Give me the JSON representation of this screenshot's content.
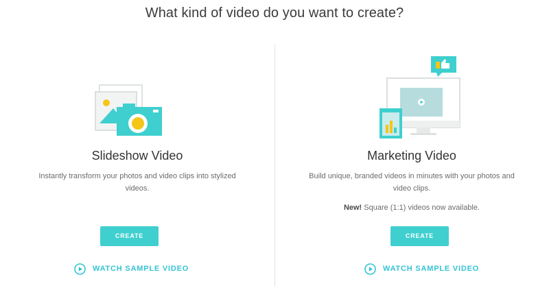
{
  "header": {
    "title": "What kind of video do you want to create?"
  },
  "cards": [
    {
      "id": "slideshow",
      "title": "Slideshow Video",
      "description": "Instantly transform your photos and video clips into stylized videos.",
      "create_label": "CREATE",
      "watch_label": "WATCH SAMPLE VIDEO",
      "illustration": "photo-camera-icon"
    },
    {
      "id": "marketing",
      "title": "Marketing Video",
      "description": "Build unique, branded videos in minutes with your photos and video clips.",
      "note_bold": "New!",
      "note_text": "Square (1:1) videos now available.",
      "create_label": "CREATE",
      "watch_label": "WATCH SAMPLE VIDEO",
      "illustration": "monitor-video-icon"
    }
  ],
  "colors": {
    "accent": "#3fcfcf",
    "link": "#33c3d4",
    "yellow": "#f5c518"
  }
}
